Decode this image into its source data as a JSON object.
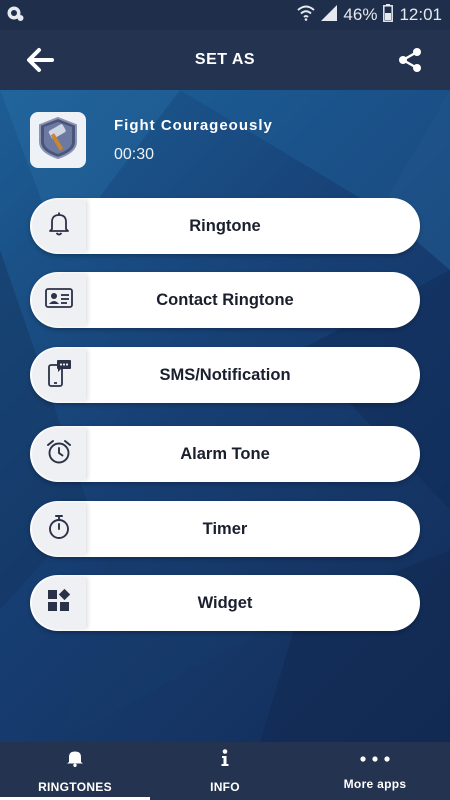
{
  "status_bar": {
    "battery": "46%",
    "time": "12:01",
    "icons": [
      "app-notification-icon",
      "wifi-icon",
      "signal-icon",
      "battery-icon"
    ]
  },
  "header": {
    "title": "SET AS",
    "back_icon": "back-arrow-icon",
    "share_icon": "share-icon"
  },
  "song": {
    "title": "Fight Courageously",
    "duration": "00:30",
    "thumbnail_icon": "hammer-badge-icon"
  },
  "options": [
    {
      "label": "Ringtone",
      "icon": "bell-icon"
    },
    {
      "label": "Contact Ringtone",
      "icon": "contact-card-icon"
    },
    {
      "label": "SMS/Notification",
      "icon": "sms-phone-icon"
    },
    {
      "label": "Alarm Tone",
      "icon": "alarm-clock-icon"
    },
    {
      "label": "Timer",
      "icon": "stopwatch-icon"
    },
    {
      "label": "Widget",
      "icon": "widget-grid-icon"
    }
  ],
  "bottom_nav": [
    {
      "label": "RINGTONES",
      "icon": "bell-icon",
      "active": true
    },
    {
      "label": "INFO",
      "icon": "info-icon",
      "active": false
    },
    {
      "label": "More apps",
      "icon": "more-dots-icon",
      "active": false
    }
  ],
  "colors": {
    "status_bar": "#1f2e4a",
    "app_bar": "#24334f",
    "background_top": "#1c5d94",
    "background_bottom": "#132c57",
    "button": "#ffffff",
    "button_icon_bg": "#eef0f4",
    "button_text": "#1a1f2e"
  }
}
